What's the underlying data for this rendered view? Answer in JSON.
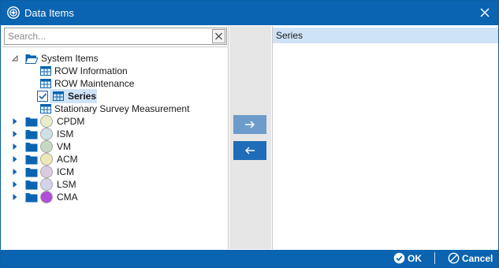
{
  "window": {
    "title": "Data Items"
  },
  "search": {
    "placeholder": "Search...",
    "value": ""
  },
  "tree": {
    "root": {
      "label": "System Items",
      "expanded": true
    },
    "children": [
      {
        "label": "ROW Information",
        "checked": false,
        "selected": false
      },
      {
        "label": "ROW Maintenance",
        "checked": false,
        "selected": false
      },
      {
        "label": "Series",
        "checked": true,
        "selected": true
      },
      {
        "label": "Stationary Survey Measurement",
        "checked": false,
        "selected": false
      }
    ],
    "groups": [
      {
        "label": "CPDM",
        "color": "#e8ecc8"
      },
      {
        "label": "ISM",
        "color": "#cfe0e4"
      },
      {
        "label": "VM",
        "color": "#c6d8c2"
      },
      {
        "label": "ACM",
        "color": "#ece6b8"
      },
      {
        "label": "ICM",
        "color": "#dccbe0"
      },
      {
        "label": "LSM",
        "color": "#d5d3ea"
      },
      {
        "label": "CMA",
        "color": "#b04ed8"
      }
    ]
  },
  "transfer": {
    "add_icon": "arrow-right-icon",
    "remove_icon": "arrow-left-icon"
  },
  "selected_list": {
    "header": "Series"
  },
  "footer": {
    "ok_label": "OK",
    "cancel_label": "Cancel"
  },
  "colors": {
    "accent": "#0a64b1",
    "selection": "#cfe3f7",
    "button": "#1f6db8",
    "button_disabled": "#6d9ccb"
  }
}
